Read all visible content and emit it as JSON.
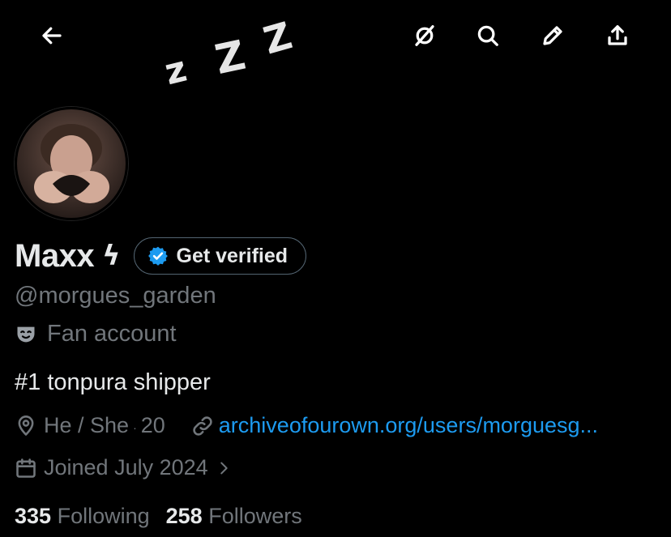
{
  "header": {
    "back_icon": "arrow-left-icon",
    "actions": [
      "mute-icon",
      "search-icon",
      "edit-pencil-icon",
      "share-icon"
    ]
  },
  "banner": {
    "sleep_glyphs": [
      "z",
      "Z",
      "Z"
    ]
  },
  "profile": {
    "display_name": "Maxx",
    "name_emoji": "ϟ",
    "verify_label": "Get verified",
    "handle": "@morgues_garden",
    "category_icon": "theater-mask-icon",
    "category": "Fan account",
    "bio": "#1 tonpura shipper",
    "location": "He / She",
    "age_separator": "·",
    "age": "20",
    "website": "archiveofourown.org/users/morguesg...",
    "joined": "Joined July 2024"
  },
  "stats": {
    "following_count": "335",
    "following_label": "Following",
    "followers_count": "258",
    "followers_label": "Followers"
  },
  "colors": {
    "background": "#000000",
    "text": "#e7e9ea",
    "muted": "#71767b",
    "link": "#1d9bf0",
    "verified": "#1d9bf0"
  }
}
